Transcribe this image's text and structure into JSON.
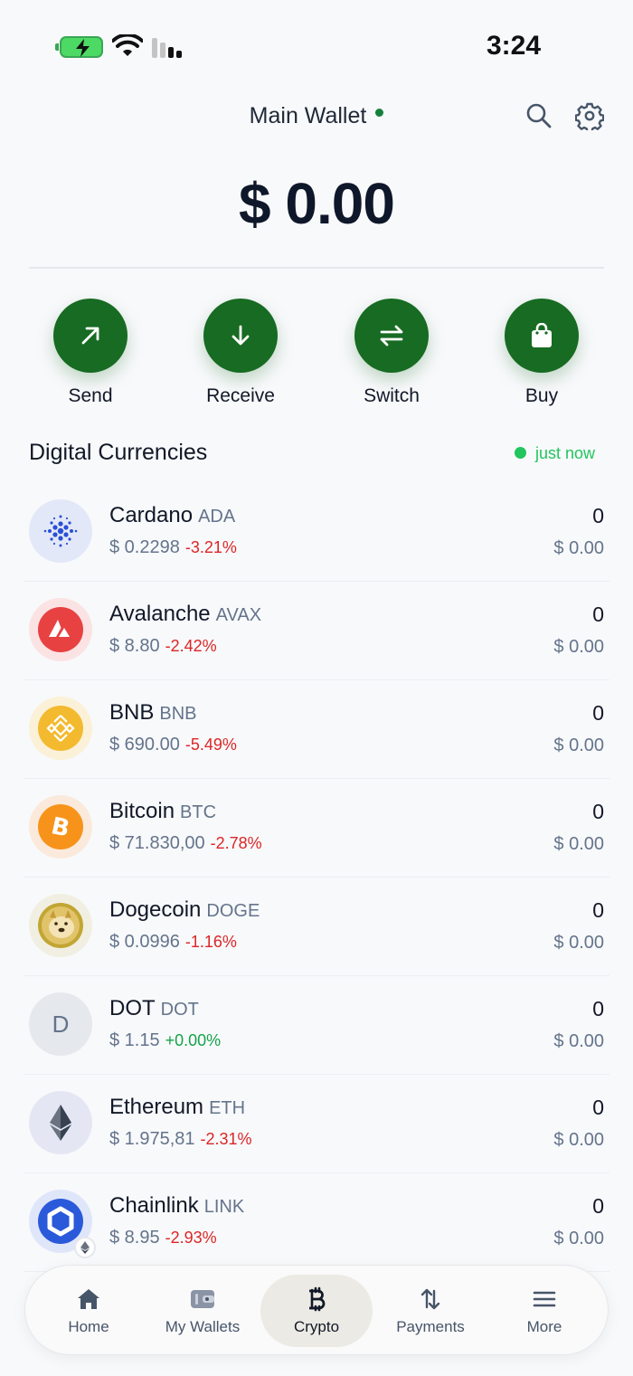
{
  "status_bar": {
    "time": "3:24"
  },
  "header": {
    "wallet_name": "Main Wallet",
    "balance": "$ 0.00"
  },
  "actions": [
    {
      "label": "Send"
    },
    {
      "label": "Receive"
    },
    {
      "label": "Switch"
    },
    {
      "label": "Buy"
    }
  ],
  "section": {
    "title": "Digital Currencies",
    "updated": "just now"
  },
  "coins": [
    {
      "name": "Cardano",
      "symbol": "ADA",
      "price": "$ 0.2298",
      "change": "-3.21%",
      "amount": "0",
      "value": "$ 0.00",
      "icon": "cardano-icon"
    },
    {
      "name": "Avalanche",
      "symbol": "AVAX",
      "price": "$ 8.80",
      "change": "-2.42%",
      "amount": "0",
      "value": "$ 0.00",
      "icon": "avalanche-icon"
    },
    {
      "name": "BNB",
      "symbol": "BNB",
      "price": "$ 690.00",
      "change": "-5.49%",
      "amount": "0",
      "value": "$ 0.00",
      "icon": "bnb-icon"
    },
    {
      "name": "Bitcoin",
      "symbol": "BTC",
      "price": "$ 71.830,00",
      "change": "-2.78%",
      "amount": "0",
      "value": "$ 0.00",
      "icon": "bitcoin-icon"
    },
    {
      "name": "Dogecoin",
      "symbol": "DOGE",
      "price": "$ 0.0996",
      "change": "-1.16%",
      "amount": "0",
      "value": "$ 0.00",
      "icon": "dogecoin-icon"
    },
    {
      "name": "DOT",
      "symbol": "DOT",
      "price": "$ 1.15",
      "change": "+0.00%",
      "amount": "0",
      "value": "$ 0.00",
      "icon": "dot-letter-icon",
      "letter": "D"
    },
    {
      "name": "Ethereum",
      "symbol": "ETH",
      "price": "$ 1.975,81",
      "change": "-2.31%",
      "amount": "0",
      "value": "$ 0.00",
      "icon": "ethereum-icon"
    },
    {
      "name": "Chainlink",
      "symbol": "LINK",
      "price": "$ 8.95",
      "change": "-2.93%",
      "amount": "0",
      "value": "$ 0.00",
      "icon": "chainlink-icon"
    }
  ],
  "nav": [
    {
      "label": "Home",
      "icon": "home-icon"
    },
    {
      "label": "My Wallets",
      "icon": "wallet-icon"
    },
    {
      "label": "Crypto",
      "icon": "bitcoin-symbol-icon",
      "active": true
    },
    {
      "label": "Payments",
      "icon": "transfer-arrows-icon"
    },
    {
      "label": "More",
      "icon": "menu-icon"
    }
  ],
  "colors": {
    "accent": "#176b22",
    "negative": "#dc2626",
    "positive": "#16a34a",
    "live": "#22c55e"
  }
}
